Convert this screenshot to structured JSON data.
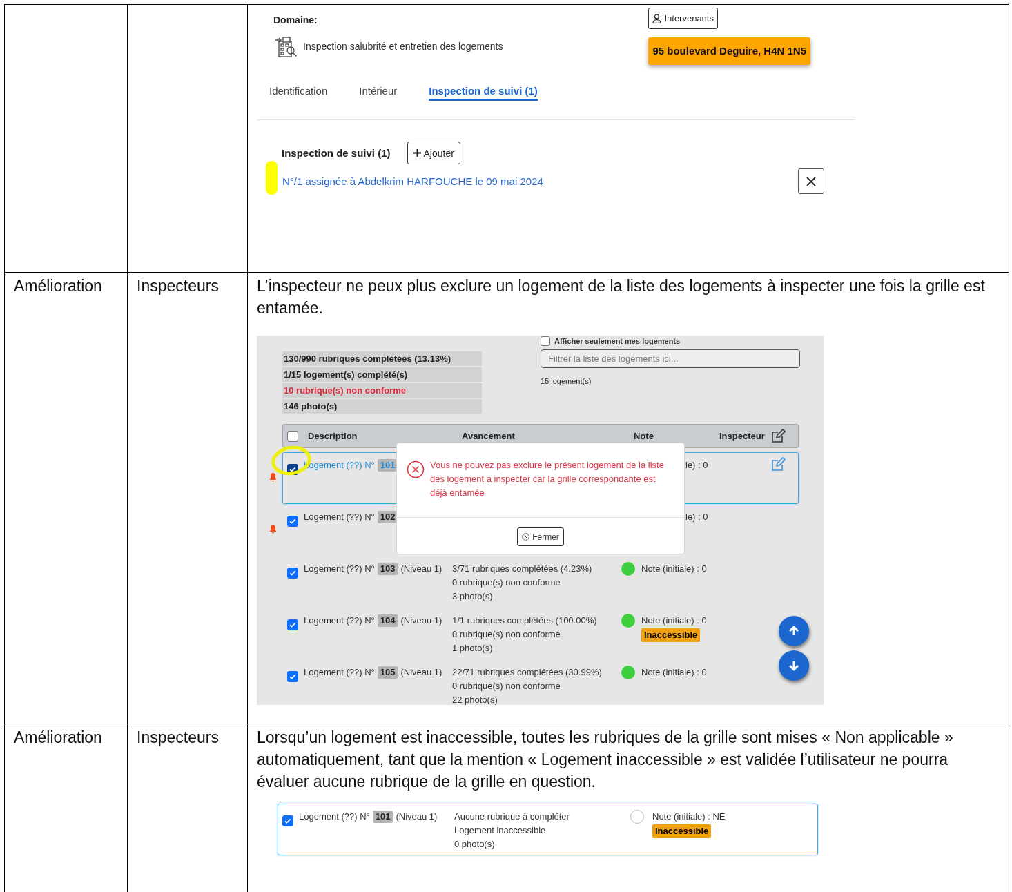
{
  "table": {
    "rows": [
      {
        "screenshot": {
          "kind": "dossier",
          "domain_label": "Domaine:",
          "domain": "Inspection salubrité et entretien des logements",
          "intervenants_button": "Intervenants",
          "address": "95 boulevard Deguire, H4N 1N5",
          "tabs": [
            {
              "label": "Identification",
              "selected": false
            },
            {
              "label": "Intérieur",
              "selected": false
            },
            {
              "label": "Inspection de suivi (1)",
              "selected": true
            }
          ],
          "section_title": "Inspection de suivi (1)",
          "add_button": "Ajouter",
          "assignment_link": "N°/1 assignée à Abdelkrim HARFOUCHE le 09 mai 2024"
        }
      },
      {
        "type": "Amélioration",
        "audience": "Inspecteurs",
        "description": "L’inspecteur ne peux plus exclure un logement de la liste des logements à inspecter une fois la grille est entamée.",
        "screenshot": {
          "kind": "liste",
          "show_mine": {
            "label": "Afficher seulement mes logements",
            "checked": false
          },
          "stats": [
            {
              "text": "130/990 rubriques complétées (13.13%)",
              "alert": false
            },
            {
              "text": "1/15 logement(s) complété(s)",
              "alert": false
            },
            {
              "text": "10 rubrique(s) non conforme",
              "alert": true
            },
            {
              "text": "146 photo(s)",
              "alert": false
            }
          ],
          "filter_placeholder": "Filtrer la liste des logements ici...",
          "count": "15 logement(s)",
          "columns": [
            "Description",
            "Avancement",
            "Note",
            "Inspecteur"
          ],
          "select_all": false,
          "rows": [
            {
              "kind": "partial",
              "checked": true,
              "selected": true,
              "hovered": true,
              "alert": true,
              "label": "Logement (??) N°",
              "number": "101",
              "note": "le) : 0"
            },
            {
              "kind": "partial",
              "checked": true,
              "selected": false,
              "hovered": false,
              "alert": true,
              "label": "Logement (??) N°",
              "number": "102",
              "note": "le) : 0"
            },
            {
              "kind": "full",
              "checked": true,
              "selected": false,
              "hovered": false,
              "alert": false,
              "label": "Logement (??) N°",
              "number": "103",
              "niveau": "(Niveau 1)",
              "progress": [
                "3/71 rubriques complétées (4.23%)",
                "0 rubrique(s) non conforme",
                "3 photo(s)"
              ],
              "color": "#3ecf3e",
              "note": "Note (initiale) : 0"
            },
            {
              "kind": "full",
              "checked": true,
              "selected": false,
              "hovered": false,
              "alert": false,
              "label": "Logement (??) N°",
              "number": "104",
              "niveau": "(Niveau 1)",
              "progress": [
                "1/1 rubriques complétées (100.00%)",
                "0 rubrique(s) non conforme",
                "1 photo(s)"
              ],
              "color": "#3ecf3e",
              "note": "Note (initiale) : 0",
              "badge": "Inaccessible"
            },
            {
              "kind": "full",
              "checked": true,
              "selected": false,
              "hovered": false,
              "alert": false,
              "label": "Logement (??) N°",
              "number": "105",
              "niveau": "(Niveau 1)",
              "progress": [
                "22/71 rubriques complétées (30.99%)",
                "0 rubrique(s) non conforme",
                "22 photo(s)"
              ],
              "color": "#3ecf3e",
              "note": "Note (initiale) : 0"
            }
          ],
          "modal": {
            "message": "Vous ne pouvez pas exclure le présent logement de la liste des logement a inspecter car la grille correspondante est déjà entamée",
            "button": "Fermer"
          }
        }
      },
      {
        "type": "Amélioration",
        "audience": "Inspecteurs",
        "description": "Lorsqu’un logement est inaccessible, toutes les rubriques de la grille sont mises « Non applicable » automatiquement, tant que la mention « Logement inaccessible » est validée l’utilisateur ne pourra évaluer aucune rubrique de la grille en question.",
        "screenshot": {
          "kind": "ligne",
          "row": {
            "kind": "full",
            "checked": true,
            "selected": true,
            "hovered": false,
            "alert": false,
            "label": "Logement (??) N°",
            "number": "101",
            "niveau": "(Niveau 1)",
            "progress": [
              "Aucune rubrique à compléter",
              "Logement inaccessible",
              "0 photo(s)"
            ],
            "note": "Note (initiale) : NE",
            "badge": "Inaccessible"
          }
        }
      }
    ]
  }
}
